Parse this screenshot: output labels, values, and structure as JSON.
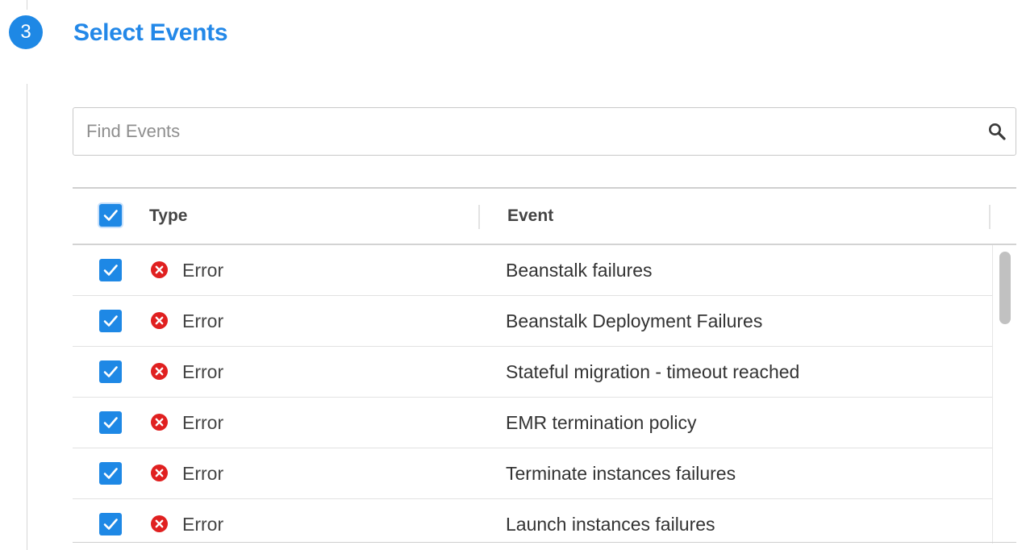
{
  "step": {
    "number": "3",
    "title": "Select Events"
  },
  "search": {
    "placeholder": "Find Events",
    "value": "",
    "icon": "search-icon"
  },
  "table": {
    "header_checked": true,
    "columns": [
      "Type",
      "Event"
    ],
    "rows": [
      {
        "checked": true,
        "type_icon": "error-icon",
        "type": "Error",
        "event": "Beanstalk failures"
      },
      {
        "checked": true,
        "type_icon": "error-icon",
        "type": "Error",
        "event": "Beanstalk Deployment Failures"
      },
      {
        "checked": true,
        "type_icon": "error-icon",
        "type": "Error",
        "event": "Stateful migration - timeout reached"
      },
      {
        "checked": true,
        "type_icon": "error-icon",
        "type": "Error",
        "event": "EMR termination policy"
      },
      {
        "checked": true,
        "type_icon": "error-icon",
        "type": "Error",
        "event": "Terminate instances failures"
      },
      {
        "checked": true,
        "type_icon": "error-icon",
        "type": "Error",
        "event": "Launch instances failures"
      }
    ]
  },
  "colors": {
    "accent": "#1e88e5",
    "title": "#2388e8",
    "error": "#e02020"
  }
}
